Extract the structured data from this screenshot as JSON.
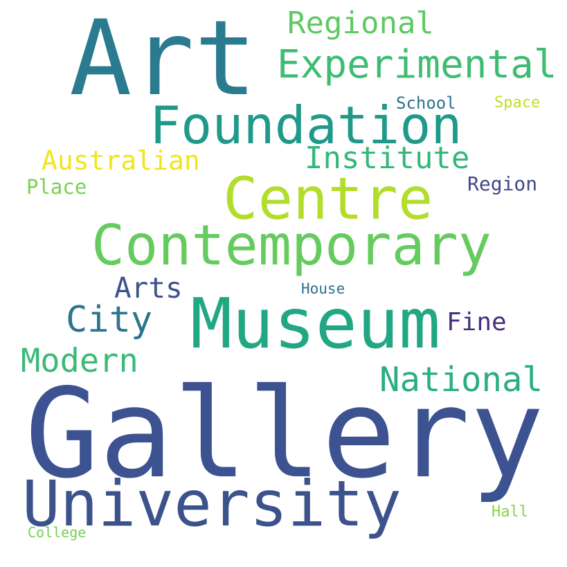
{
  "words": [
    {
      "text": "Gallery",
      "color": "#3d5290"
    },
    {
      "text": "Art",
      "color": "#2a7b8f"
    },
    {
      "text": "Museum",
      "color": "#22a785"
    },
    {
      "text": "Contemporary",
      "color": "#65cb5e"
    },
    {
      "text": "Foundation",
      "color": "#1f9a8a"
    },
    {
      "text": "Centre",
      "color": "#b2dd2d"
    },
    {
      "text": "University",
      "color": "#3b528b"
    },
    {
      "text": "Experimental",
      "color": "#3ebc73"
    },
    {
      "text": "Regional",
      "color": "#5ec962"
    },
    {
      "text": "Institute",
      "color": "#35b779"
    },
    {
      "text": "National",
      "color": "#29af7f"
    },
    {
      "text": "Modern",
      "color": "#3aba76"
    },
    {
      "text": "City",
      "color": "#2b758e"
    },
    {
      "text": "Arts",
      "color": "#3b528b"
    },
    {
      "text": "Australian",
      "color": "#f0e51c"
    },
    {
      "text": "Fine",
      "color": "#472f7d"
    },
    {
      "text": "Region",
      "color": "#3f4889"
    },
    {
      "text": "Place",
      "color": "#7ad151"
    },
    {
      "text": "School",
      "color": "#2c728e"
    },
    {
      "text": "Space",
      "color": "#c0de26"
    },
    {
      "text": "House",
      "color": "#2e6f8e"
    },
    {
      "text": "Hall",
      "color": "#86d549"
    },
    {
      "text": "College",
      "color": "#75d054"
    }
  ]
}
